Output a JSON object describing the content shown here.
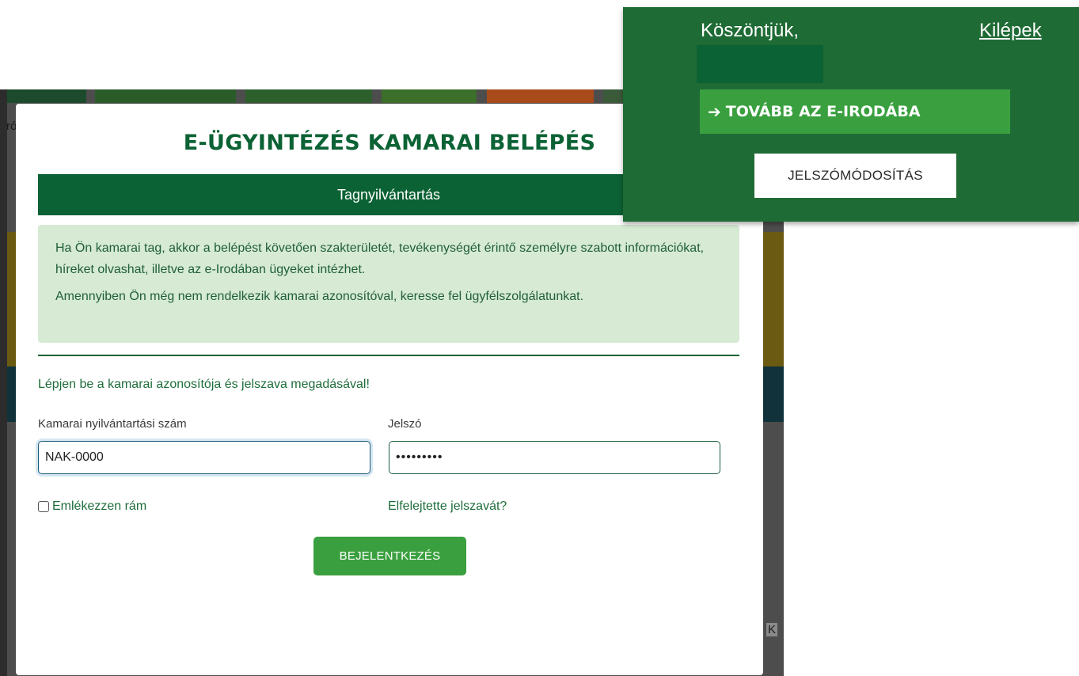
{
  "background": {
    "fragment_left": "ró",
    "fragment_right": "K",
    "strip_colors": [
      "#1c4a2c",
      "#2a5c2a",
      "#2c5f2c",
      "#3b6f2a",
      "#a94a1a",
      "#3a5a3a"
    ]
  },
  "modal": {
    "title": "E-ÜGYINTÉZÉS KAMARAI BELÉPÉS",
    "tab_label": "Tagnyilvántartás",
    "info_paragraph_1": "Ha Ön kamarai tag, akkor a belépést követően szakterületét, tevékenységét érintő személyre szabott információkat, híreket olvashat, illetve az e-Irodában ügyeket intézhet.",
    "info_paragraph_2": "Amennyiben Ön még nem rendelkezik kamarai azonosítóval, keresse fel ügyfélszolgálatunkat.",
    "instruction": "Lépjen be a kamarai azonosítója és jelszava megadásával!",
    "id_field": {
      "label": "Kamarai nyilvántartási szám",
      "value": "NAK-0000"
    },
    "password_field": {
      "label": "Jelszó",
      "value": "•••••••••"
    },
    "remember_label": "Emlékezzen rám",
    "remember_checked": false,
    "forgot_link": "Elfelejtette jelszavát?",
    "login_button": "BEJELENTKEZÉS"
  },
  "panel": {
    "greeting": "Köszöntjük,",
    "logout_link": "Kilépek",
    "eoffice_button": "TOVÁBB AZ E-IRODÁBA",
    "eoffice_arrow": "➔",
    "password_change_button": "JELSZÓMÓDOSÍTÁS"
  },
  "colors": {
    "brand_dark_green": "#0b6234",
    "panel_green": "#1f6b35",
    "accent_green": "#3aa03f",
    "info_bg": "#d6ead4"
  }
}
